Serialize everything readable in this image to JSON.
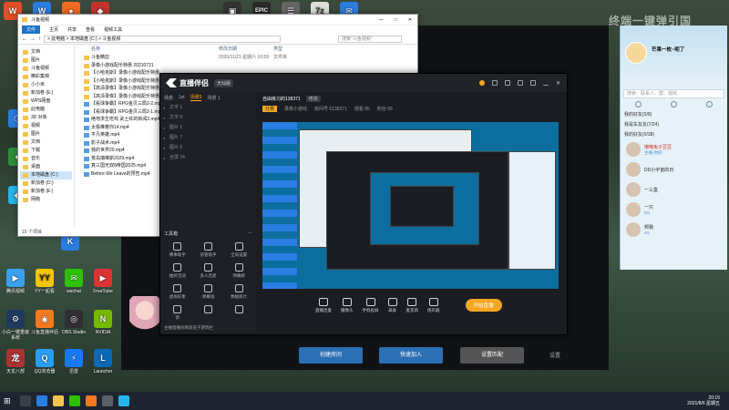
{
  "desktop": {
    "icons_top": [
      "",
      "",
      "",
      "",
      "",
      "",
      "",
      "",
      "",
      "",
      "",
      "",
      "",
      ""
    ],
    "icons_left": [
      {
        "label": "腾讯视频"
      },
      {
        "label": "YY一起看"
      },
      {
        "label": "wechat"
      },
      {
        "label": "FreeTube"
      },
      {
        "label": "小白一键重装系统"
      },
      {
        "label": "斗鱼直播伴侣"
      },
      {
        "label": "OBS Studio"
      },
      {
        "label": "NVIDIA"
      },
      {
        "label": "天龙八部"
      },
      {
        "label": "QQ浏览器"
      },
      {
        "label": "迅雷"
      },
      {
        "label": "Launcher"
      }
    ]
  },
  "explorer": {
    "title": "斗鱼视频",
    "ribbon": {
      "file": "文件",
      "home": "主页",
      "share": "共享",
      "view": "查看",
      "video_tools": "视频工具"
    },
    "address": "> 此电脑 > 本地磁盘 (C:) > 斗鱼视频",
    "search_placeholder": "搜索\"斗鱼视频\"",
    "nav_items": [
      "文档",
      "图片",
      "斗鱼视频",
      "精彩集锦",
      "小小米",
      "新加卷 (E:)",
      "WPS网盘",
      "此电脑",
      "3D 对象",
      "视频",
      "图片",
      "文档",
      "下载",
      "音乐",
      "桌面",
      "本地磁盘 (C:)",
      "新加卷 (D:)",
      "新加卷 (E:)",
      "网络"
    ],
    "nav_selected": 15,
    "columns": {
      "name": "名称",
      "date": "修改日期",
      "type": "类型"
    },
    "date_sample": "2020/11/21 星期六 16:59",
    "type_sample": "文件夹",
    "files": [
      "斗鱼精剪",
      "录像小游戏配乐特惠 20210721",
      "【小哈克斯】录像小游戏配乐特惠",
      "【小哈克斯】录像小游戏配乐特惠",
      "【高清录像】录像小游戏配乐特惠",
      "【高清录像】录像小游戏配乐特惠",
      "【看球争霸】RPG金贝三局2-2.mp4",
      "【看球争霸】RPG金贝三局2-1.mp4",
      "绝地求生吃鸡 武士红的新闻2.mp4",
      "太极推着你14.mp4",
      "平凡英雄.mp4",
      "影子战术.mp4",
      "我的世界20.mp4",
      "荒岛瑞维斯2029.mp4",
      "真三国无双8帝国2025.mp4",
      "Before We Leave的预告.mp4"
    ],
    "status": "15 个项目"
  },
  "streamer": {
    "app_name": "直播伴侣",
    "edition": "天仙版",
    "scene_tabs": [
      "场景",
      "1st",
      "场景5",
      "场景 1"
    ],
    "sources": [
      "文字 1",
      "文字 0",
      "图片 1",
      "图片 7",
      "图片 5",
      "全屏 24"
    ],
    "tools_title": "工具箱",
    "tools": [
      "赛事助手",
      "房管助手",
      "全局设置",
      "抽奖活动",
      "多人连麦",
      "弹幕姬",
      "虚拟形象",
      "弹幕墙",
      "数据统计",
      "新",
      "",
      ""
    ],
    "announce": "主播直播间目前处于游戏栏",
    "room": {
      "title": "自由练习的138371",
      "badge": "修改",
      "category": "分类",
      "line2": [
        "录像小游戏",
        "房间号 6138371",
        "观看 85",
        "粉丝 65"
      ]
    },
    "bottom_buttons": [
      "直播连麦",
      "摄像头",
      "手机投屏",
      "录屏",
      "麦克风",
      "扬声器"
    ],
    "golive": "开始直播"
  },
  "backdrop": {
    "buttons": [
      "创建房间",
      "快速加入",
      "设置匹配"
    ],
    "corner": "设置"
  },
  "qq": {
    "name": "芒果一枚~呃了",
    "search_placeholder": "搜索：联系人、群、视频",
    "groups": [
      "我的好友(0/8)",
      "我是车友友(7/24)",
      "我的好友(0/38)"
    ],
    "contacts": [
      {
        "name": "懒懒兔子豆豆",
        "status": "主播-你好",
        "red": true
      },
      {
        "name": "DD小宇宙的日",
        "status": "",
        "red": false
      },
      {
        "name": "一三盒",
        "status": "",
        "red": false
      },
      {
        "name": "一只",
        "status": "5G",
        "red": false
      },
      {
        "name": "邦我",
        "status": "4G",
        "red": false
      }
    ]
  },
  "watermark": "终端一键弹引国",
  "taskbar": {
    "time": "20:15",
    "date": "2021/8/6 星期五"
  }
}
